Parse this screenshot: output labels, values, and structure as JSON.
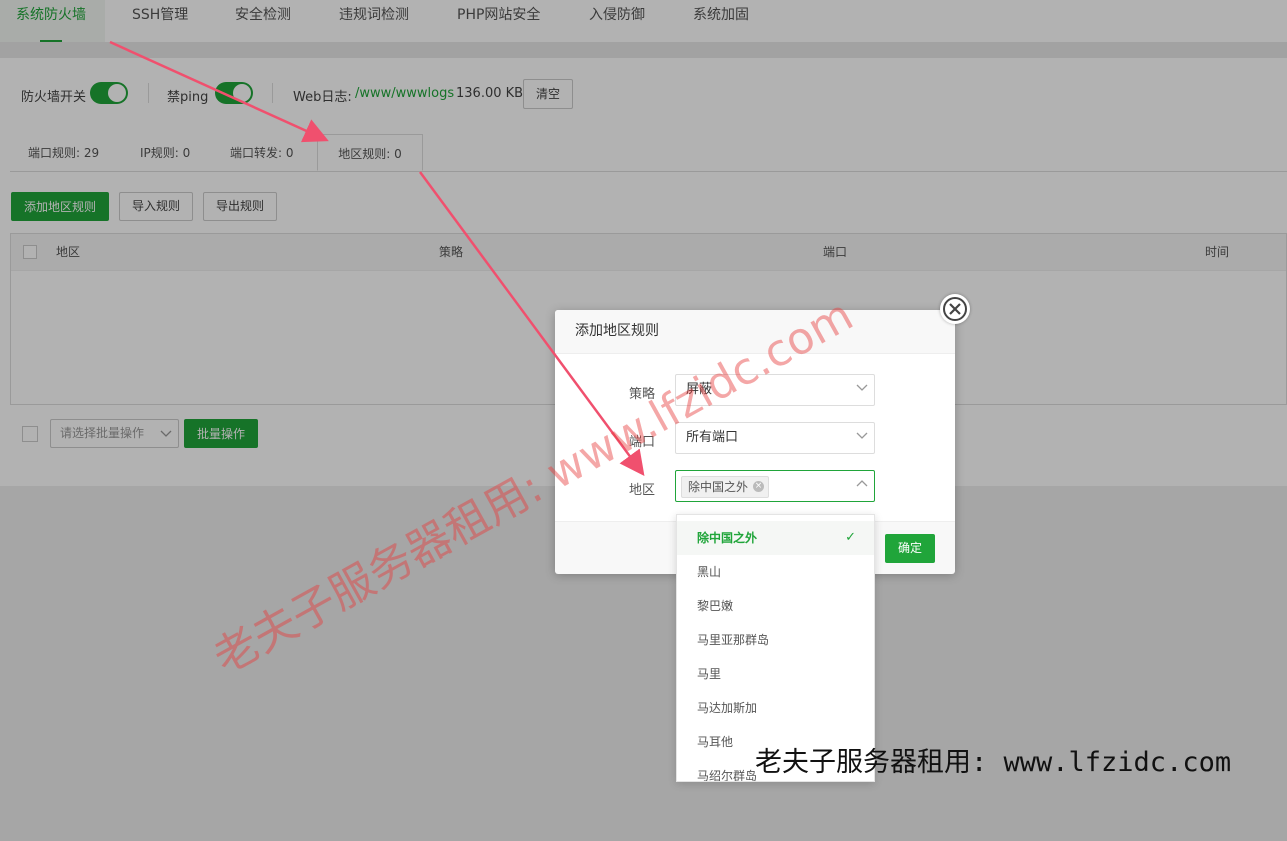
{
  "top_tabs": [
    "系统防火墙",
    "SSH管理",
    "安全检测",
    "违规词检测",
    "PHP网站安全",
    "入侵防御",
    "系统加固"
  ],
  "toolbar": {
    "firewall_label": "防火墙开关",
    "ping_label": "禁ping",
    "weblog_label": "Web日志:",
    "weblog_path": "/www/wwwlogs",
    "weblog_size": "136.00 KB",
    "clear_button": "清空"
  },
  "sub_tabs": [
    "端口规则: 29",
    "IP规则: 0",
    "端口转发: 0",
    "地区规则: 0"
  ],
  "actions": {
    "add_region": "添加地区规则",
    "import": "导入规则",
    "export": "导出规则"
  },
  "table": {
    "headers": [
      "地区",
      "策略",
      "端口",
      "时间"
    ]
  },
  "batch": {
    "select_placeholder": "请选择批量操作",
    "batch_button": "批量操作"
  },
  "modal": {
    "title": "添加地区规则",
    "policy_label": "策略",
    "policy_value": "屏蔽",
    "port_label": "端口",
    "port_value": "所有端口",
    "region_label": "地区",
    "region_chip": "除中国之外",
    "ok_button": "确定"
  },
  "dropdown": {
    "options": [
      "除中国之外",
      "黑山",
      "黎巴嫩",
      "马里亚那群岛",
      "马里",
      "马达加斯加",
      "马耳他",
      "马绍尔群岛"
    ]
  },
  "watermark": {
    "diagonal": "老夫子服务器租用: www.lfzidc.com",
    "bottom": "老夫子服务器租用: www.lfzidc.com"
  },
  "colors": {
    "accent": "#20a53a",
    "watermark": "#e63c3c"
  }
}
